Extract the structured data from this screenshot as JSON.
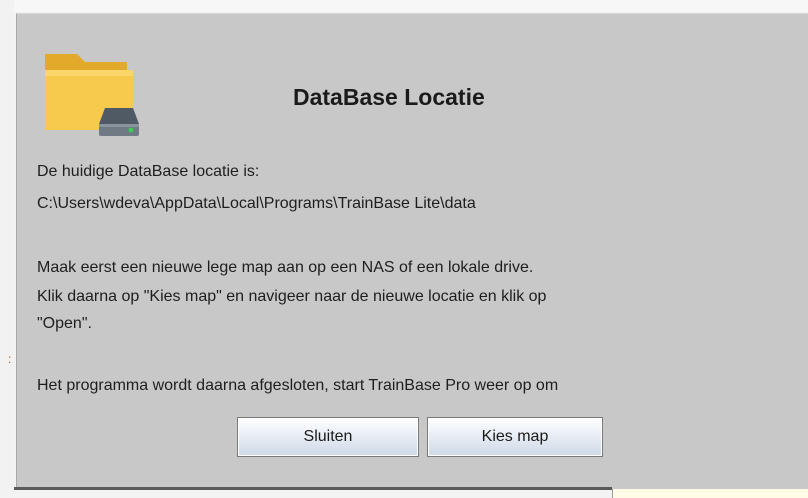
{
  "dialog": {
    "title": "DataBase Locatie",
    "icon": "folder-drive-icon",
    "lines": {
      "current_label": "De huidige DataBase locatie is:",
      "current_path": "C:\\Users\\wdeva\\AppData\\Local\\Programs\\TrainBase Lite\\data",
      "instruction_1": "Maak eerst een nieuwe lege map aan op een NAS of een lokale drive.",
      "instruction_2": "Klik daarna op \"Kies map\" en navigeer naar de nieuwe locatie en klik op",
      "instruction_3": "\"Open\".",
      "note": "Het programma wordt daarna afgesloten, start TrainBase Pro weer op om"
    },
    "buttons": {
      "close_label": "Sluiten",
      "choose_label": "Kies map"
    }
  },
  "colors": {
    "dialog_bg": "#c8c8c8",
    "folder_yellow": "#f6c44a",
    "folder_dark": "#e0a82a",
    "drive_gray": "#5f6b76",
    "drive_led": "#3ccf4e"
  }
}
